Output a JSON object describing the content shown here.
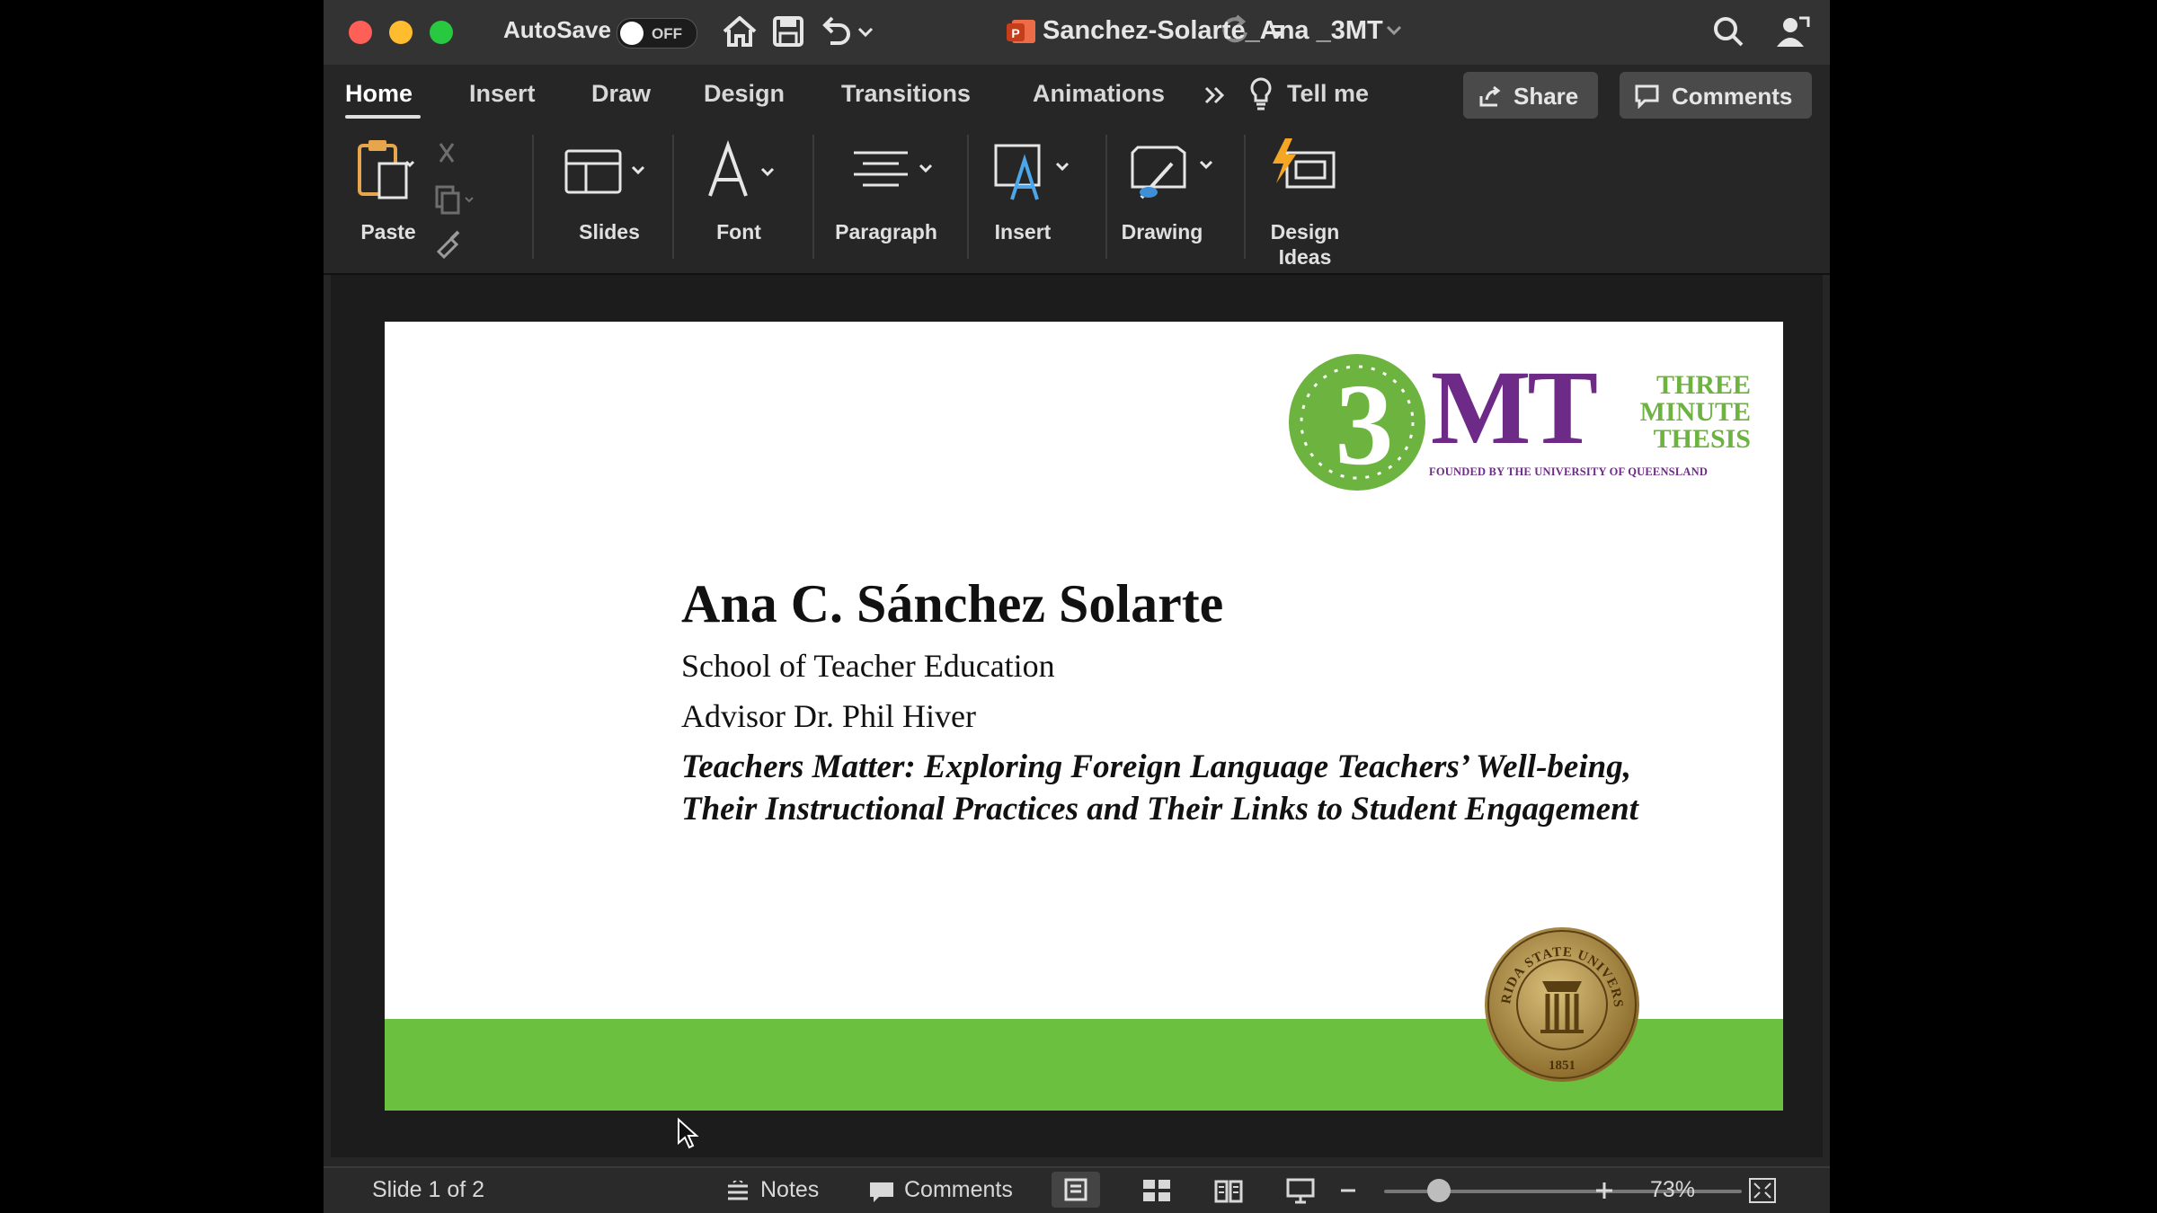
{
  "titlebar": {
    "autosave_label": "AutoSave",
    "autosave_state": "OFF",
    "document_title": "Sanchez-Solarte_Ana _3MT",
    "icons": [
      "close-button",
      "minimize-button",
      "maximize-button",
      "home-icon",
      "save-icon",
      "undo-icon",
      "redo-icon",
      "customize-toolbar-icon",
      "powerpoint-icon",
      "search-icon",
      "account-icon"
    ]
  },
  "tabs": [
    {
      "label": "Home"
    },
    {
      "label": "Insert"
    },
    {
      "label": "Draw"
    },
    {
      "label": "Design"
    },
    {
      "label": "Transitions"
    },
    {
      "label": "Animations"
    }
  ],
  "tell_me": "Tell me",
  "share_label": "Share",
  "comments_label": "Comments",
  "ribbon": {
    "paste": "Paste",
    "slides": "Slides",
    "font": "Font",
    "paragraph": "Paragraph",
    "insert": "Insert",
    "drawing": "Drawing",
    "design_ideas_line1": "Design",
    "design_ideas_line2": "Ideas"
  },
  "slide": {
    "logo": {
      "mark": "MT",
      "line1": "THREE",
      "line2": "MINUTE",
      "line3": "THESIS",
      "founded": "FOUNDED BY THE UNIVERSITY OF QUEENSLAND"
    },
    "presenter_name": "Ana C. Sánchez Solarte",
    "school": "School of Teacher Education",
    "advisor": "Advisor Dr. Phil Hiver",
    "thesis_title": "Teachers Matter: Exploring Foreign Language Teachers’ Well-being, Their Instructional Practices and Their Links to Student Engagement",
    "seal": {
      "text": "FLORIDA STATE UNIVERSITY",
      "year": "1851"
    },
    "colors": {
      "band": "#6cc040",
      "purple": "#6d2a86",
      "gold": "#8a6a2a"
    }
  },
  "statusbar": {
    "slide_counter": "Slide 1 of 2",
    "notes_label": "Notes",
    "comments_label": "Comments",
    "zoom_percent": "73%",
    "zoom_fraction": 0.12
  }
}
